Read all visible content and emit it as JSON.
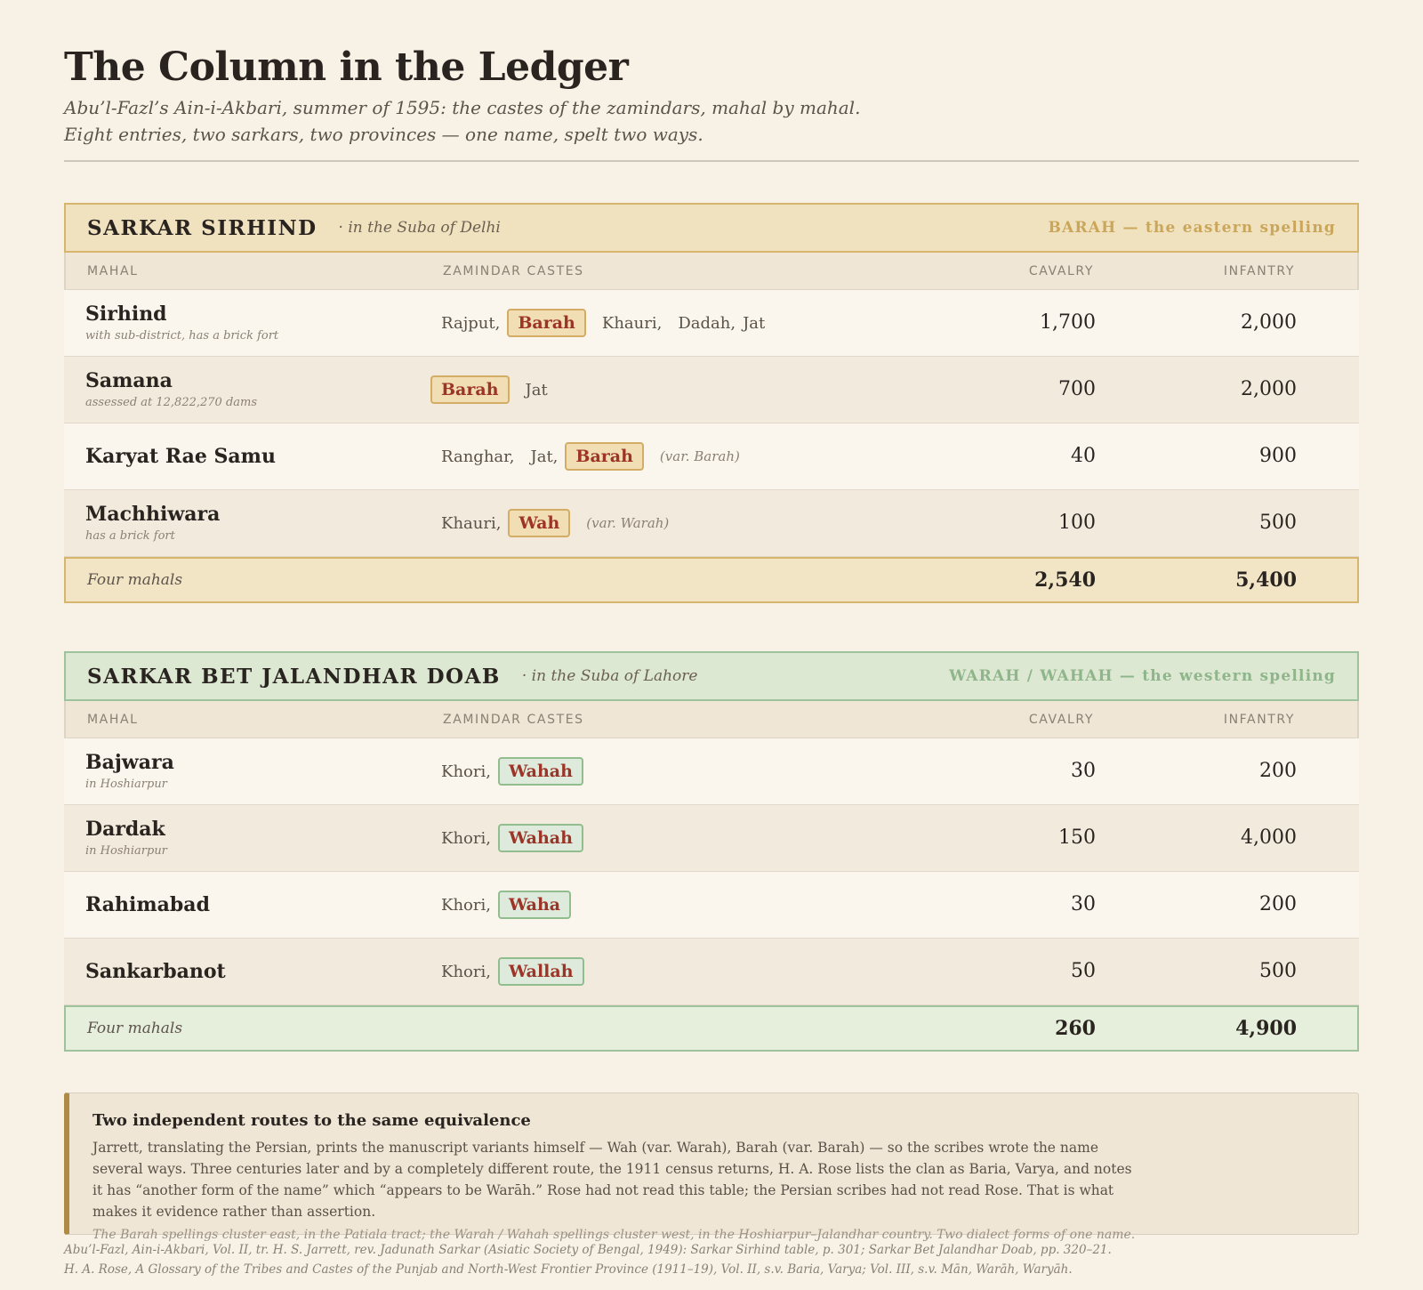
{
  "header": {
    "title": "The Column in the Ledger",
    "subtitle_1": "Abu’l-Fazl’s Ain-i-Akbari, summer of 1595: the castes of the zamindars, mahal by mahal.",
    "subtitle_2": "Eight entries, two sarkars, two provinces — one name, spelt two ways."
  },
  "columns": {
    "mahal": "MAHAL",
    "castes": "ZAMINDAR CASTES",
    "cavalry": "CAVALRY",
    "infantry": "INFANTRY"
  },
  "colors": {
    "east_accent": "#d6b56c",
    "west_accent": "#9dc29c",
    "highlight_text": "#9c3428"
  },
  "sirhind": {
    "name": "SARKAR SIRHIND",
    "suba": "· in the Suba of Delhi",
    "spelling": "BARAH — the eastern spelling",
    "rows": [
      {
        "mahal": "Sirhind",
        "note": "with sub-district, has a brick fort",
        "pre": "Rajput,",
        "tag": "Barah",
        "post_1": "Khauri,",
        "post_2": "Dadah,",
        "post_3": "Jat",
        "cavalry": "1,700",
        "infantry": "2,000"
      },
      {
        "mahal": "Samana",
        "note": "assessed at 12,822,270 dams",
        "tag": "Barah",
        "post_1": "Jat",
        "cavalry": "700",
        "infantry": "2,000"
      },
      {
        "mahal": "Karyat Rae Samu",
        "pre_1": "Ranghar,",
        "pre_2": "Jat,",
        "tag": "Barah",
        "var": "(var. Barah)",
        "cavalry": "40",
        "infantry": "900"
      },
      {
        "mahal": "Machhiwara",
        "note": "has a brick fort",
        "pre": "Khauri,",
        "tag": "Wah",
        "var": "(var. Warah)",
        "cavalry": "100",
        "infantry": "500"
      }
    ],
    "total": {
      "label": "Four mahals",
      "cavalry": "2,540",
      "infantry": "5,400"
    }
  },
  "jalandhar": {
    "name": "SARKAR BET JALANDHAR DOAB",
    "suba": "· in the Suba of Lahore",
    "spelling": "WARAH / WAHAH — the western spelling",
    "rows": [
      {
        "mahal": "Bajwara",
        "note": "in Hoshiarpur",
        "pre": "Khori,",
        "tag": "Wahah",
        "cavalry": "30",
        "infantry": "200"
      },
      {
        "mahal": "Dardak",
        "note": "in Hoshiarpur",
        "pre": "Khori,",
        "tag": "Wahah",
        "cavalry": "150",
        "infantry": "4,000"
      },
      {
        "mahal": "Rahimabad",
        "pre": "Khori,",
        "tag": "Waha",
        "cavalry": "30",
        "infantry": "200"
      },
      {
        "mahal": "Sankarbanot",
        "pre": "Khori,",
        "tag": "Wallah",
        "cavalry": "50",
        "infantry": "500"
      }
    ],
    "total": {
      "label": "Four mahals",
      "cavalry": "260",
      "infantry": "4,900"
    }
  },
  "callout": {
    "title": "Two independent routes to the same equivalence",
    "body": "Jarrett, translating the Persian, prints the manuscript variants himself — Wah (var. Warah), Barah (var. Barah) — so the scribes wrote the name several ways. Three centuries later and by a completely different route, the 1911 census returns, H. A. Rose lists the clan as Baria, Varya, and notes it has “another form of the name” which “appears to be Warāh.” Rose had not read this table; the Persian scribes had not read Rose. That is what makes it evidence rather than assertion.",
    "small": "The Barah spellings cluster east, in the Patiala tract; the Warah / Wahah spellings cluster west, in the Hoshiarpur–Jalandhar country. Two dialect forms of one name."
  },
  "refs": {
    "line_1": "Abu’l-Fazl, Ain-i-Akbari, Vol. II, tr. H. S. Jarrett, rev. Jadunath Sarkar (Asiatic Society of Bengal, 1949): Sarkar Sirhind table, p. 301; Sarkar Bet Jalandhar Doab, pp. 320–21.",
    "line_2": "H. A. Rose, A Glossary of the Tribes and Castes of the Punjab and North-West Frontier Province (1911–19), Vol. II, s.v. Baria, Varya; Vol. III, s.v. Mān, Warāh, Waryāh."
  }
}
